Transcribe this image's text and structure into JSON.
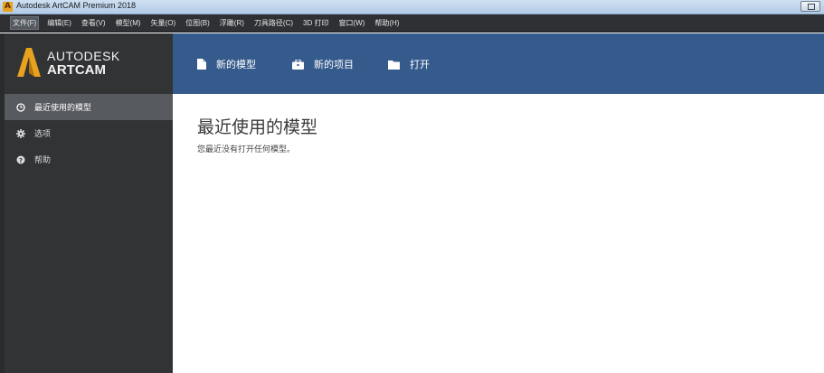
{
  "window": {
    "title": "Autodesk ArtCAM Premium 2018",
    "app_icon_letter": "A"
  },
  "menubar": {
    "items": [
      {
        "label": "文件(F)"
      },
      {
        "label": "编辑(E)"
      },
      {
        "label": "查看(V)"
      },
      {
        "label": "模型(M)"
      },
      {
        "label": "矢量(O)"
      },
      {
        "label": "位图(B)"
      },
      {
        "label": "浮雕(R)"
      },
      {
        "label": "刀具路径(C)"
      },
      {
        "label": "3D 打印"
      },
      {
        "label": "窗口(W)"
      },
      {
        "label": "帮助(H)"
      }
    ]
  },
  "brand": {
    "line1": "AUTODESK",
    "line2": "ARTCAM",
    "accent": "#e8a21f"
  },
  "sidebar": {
    "items": [
      {
        "label": "最近使用的模型",
        "icon": "clock-icon",
        "selected": true
      },
      {
        "label": "选项",
        "icon": "gear-icon",
        "selected": false
      },
      {
        "label": "帮助",
        "icon": "question-icon",
        "selected": false
      }
    ]
  },
  "header": {
    "actions": [
      {
        "label": "新的模型",
        "icon": "document-icon"
      },
      {
        "label": "新的项目",
        "icon": "briefcase-icon"
      },
      {
        "label": "打开",
        "icon": "folder-icon"
      }
    ],
    "color": "#355a8c"
  },
  "main": {
    "title": "最近使用的模型",
    "message": "您最近没有打开任何模型。"
  }
}
